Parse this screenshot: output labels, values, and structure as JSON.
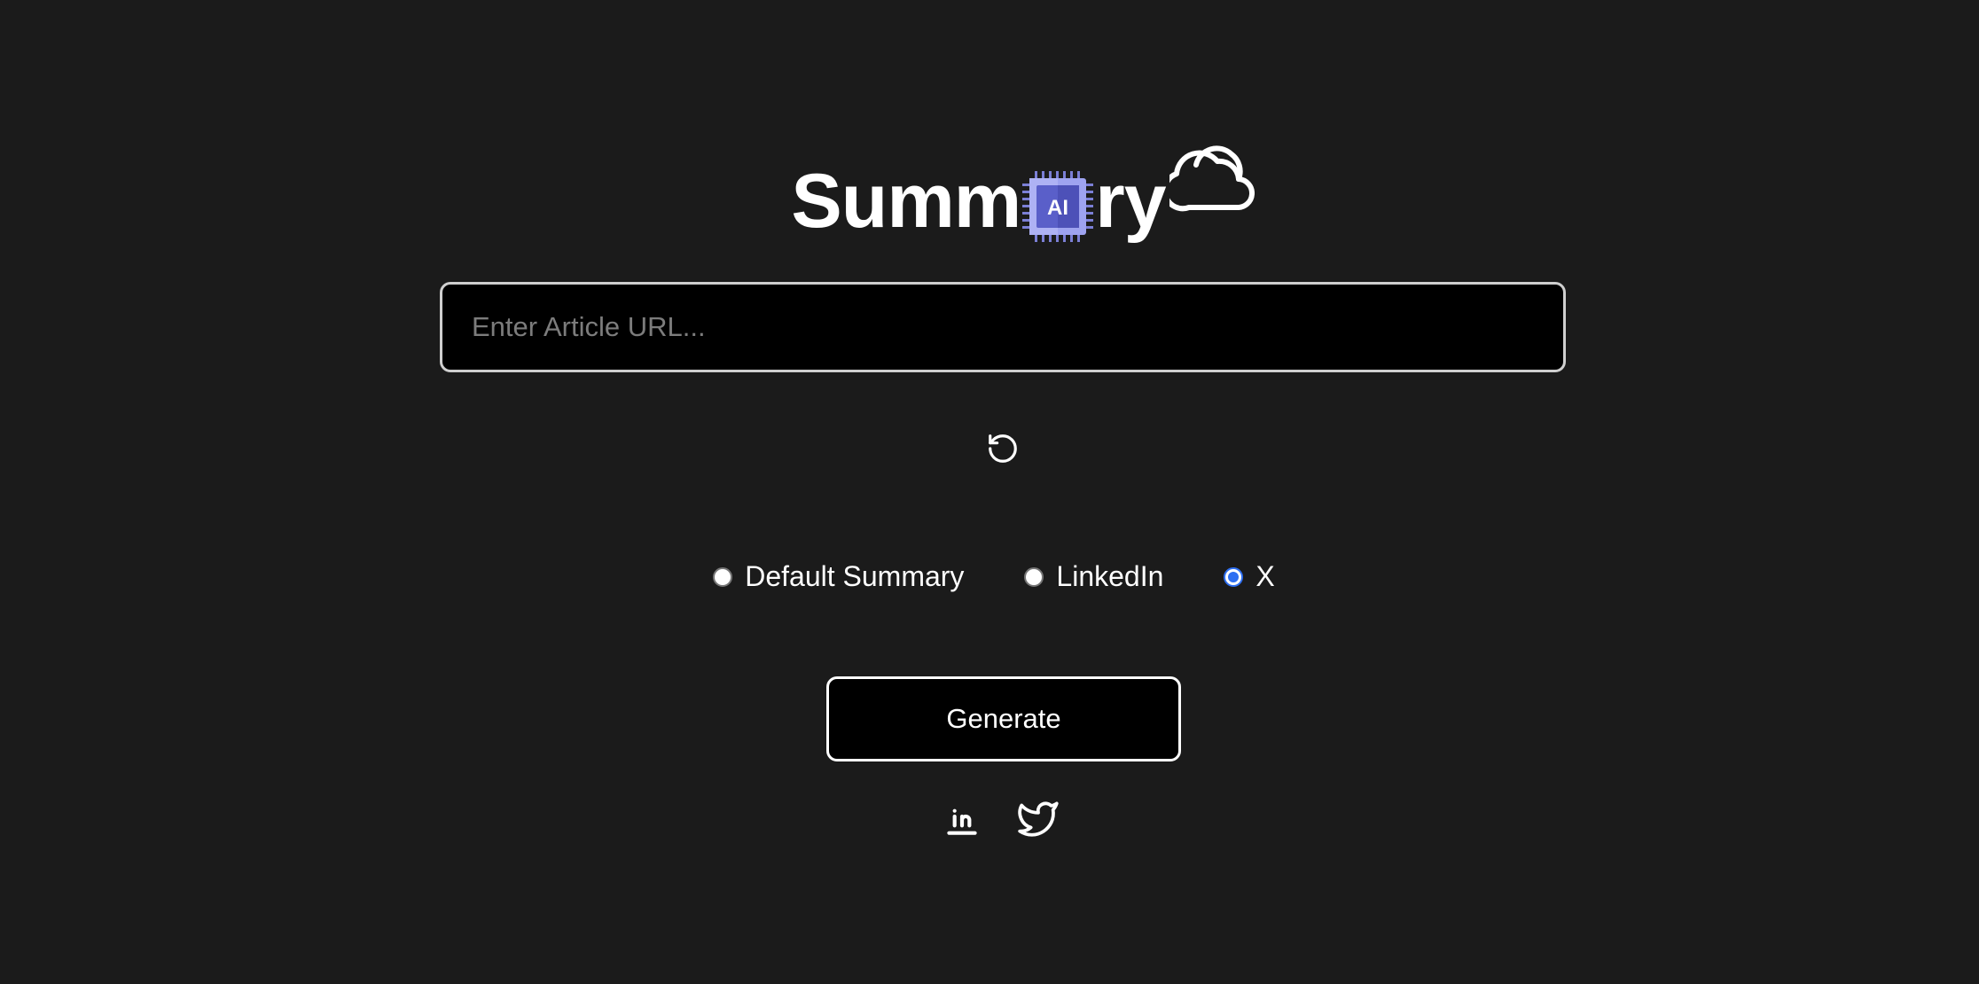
{
  "logo": {
    "text_before": "Summ",
    "chip_label": "AI",
    "text_after": "ry",
    "chip_colors": {
      "outer": "#7b7fd6",
      "inner": "#5a5fc9",
      "light": "#9ea3f0"
    }
  },
  "url_input": {
    "placeholder": "Enter Article URL...",
    "value": ""
  },
  "reset": {
    "icon": "rotate-ccw-icon"
  },
  "options": [
    {
      "label": "Default Summary",
      "checked": false
    },
    {
      "label": "LinkedIn",
      "checked": false
    },
    {
      "label": "X",
      "checked": true
    }
  ],
  "generate": {
    "label": "Generate"
  },
  "social": [
    {
      "icon": "linkedin-icon"
    },
    {
      "icon": "twitter-icon"
    }
  ],
  "colors": {
    "background": "#1b1b1b",
    "accent": "#2e6ff2"
  }
}
